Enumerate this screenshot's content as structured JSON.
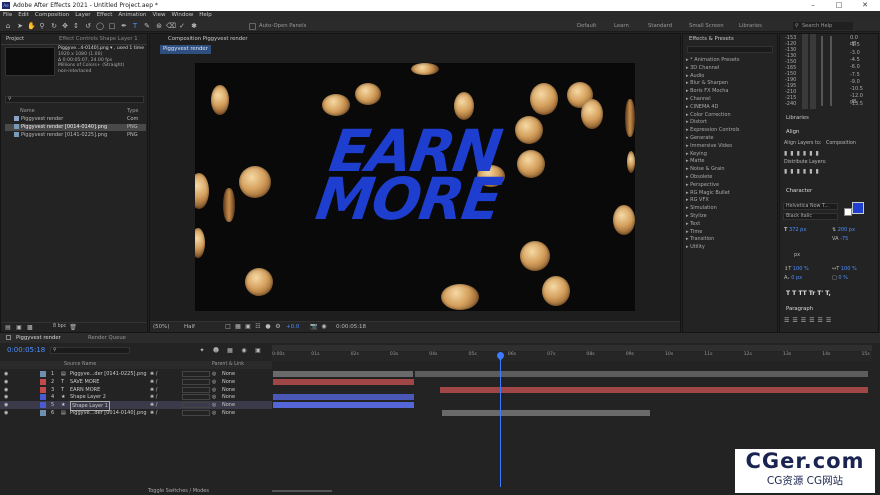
{
  "window": {
    "title": "Adobe After Effects 2021 - Untitled Project.aep *"
  },
  "menu": [
    "File",
    "Edit",
    "Composition",
    "Layer",
    "Effect",
    "Animation",
    "View",
    "Window",
    "Help"
  ],
  "toolbar": {
    "auto_open": "Auto-Open Panels",
    "workspaces": [
      "Default",
      "Learn",
      "Standard",
      "Small Screen",
      "Libraries"
    ],
    "search": "Search Help"
  },
  "project": {
    "tab_project": "Project",
    "tab_effects": "Effect Controls Shape Layer 1",
    "selected": "Piggyve...4-0140].png ▾ , used 1 time",
    "info": [
      "1920 x 1080 (1.00)",
      "Δ 0:00:05:07, 24.00 fps",
      "Millions of Colors+ (Straight)",
      "non-interlaced"
    ],
    "col_name": "Name",
    "col_type": "Type",
    "items": [
      {
        "name": "Piggyvest render",
        "type": "Com"
      },
      {
        "name": "Piggyvest render [0014-0140].png",
        "type": "PNG"
      },
      {
        "name": "Piggyvest render [0141-0225].png",
        "type": "PNG"
      }
    ],
    "bpc": "8 bpc"
  },
  "composition": {
    "tab": "Composition Piggyvest render",
    "crumb": "Piggyvest render",
    "headline": [
      "EARN",
      "MORE"
    ],
    "zoom": "(50%)",
    "quality": "Half",
    "exposure": "+0.0",
    "timecode": "0:00:05:18"
  },
  "effects_presets": {
    "title": "Effects & Presets",
    "items": [
      "* Animation Presets",
      "3D Channel",
      "Audio",
      "Blur & Sharpen",
      "Boris FX Mocha",
      "Channel",
      "CINEMA 4D",
      "Color Correction",
      "Distort",
      "Expression Controls",
      "Generate",
      "Immersive Video",
      "Keying",
      "Matte",
      "Noise & Grain",
      "Obsolete",
      "Perspective",
      "RG Magic Bullet",
      "RG VFX",
      "Simulation",
      "Stylize",
      "Text",
      "Time",
      "Transition",
      "Utility"
    ]
  },
  "audio": {
    "left_db": [
      "-153",
      "-120",
      "-130",
      "-130",
      "-150",
      "-165",
      "-150",
      "-190",
      "-195",
      "-210",
      "-215",
      "-240"
    ],
    "right_db": [
      "0.0 dB",
      "-1.5",
      "-3.0",
      "-4.5",
      "-6.0",
      "-7.5",
      "-9.0",
      "-10.5",
      "-12.0 dB",
      "-13.5"
    ]
  },
  "right": {
    "libraries": "Libraries",
    "align": "Align",
    "align_to_label": "Align Layers to:",
    "align_to": "Composition",
    "distribute": "Distribute Layers:",
    "character": "Character",
    "font": "Helvetica Now T...",
    "style": "Black Italic",
    "size": "372 px",
    "leading": "200 px",
    "tracking": "-75",
    "px_unit": "px",
    "vscale": "100 %",
    "hscale": "100 %",
    "baseline": "0 px",
    "tsume": "0 %",
    "text_style": "T  T  TT Tr  T'  T,",
    "paragraph": "Paragraph"
  },
  "timeline": {
    "tab_comp": "Piggyvest render",
    "tab_queue": "Render Queue",
    "timecode": "0:00:05:18",
    "col_source": "Source Name",
    "col_parent": "Parent & Link",
    "layers": [
      {
        "num": "1",
        "name": "Piggyve...der [0141-0225].png",
        "parent": "None",
        "color": "#6e8fb0",
        "icon": "img"
      },
      {
        "num": "2",
        "name": "SAVE MORE",
        "parent": "None",
        "color": "#c24a4a",
        "icon": "T"
      },
      {
        "num": "3",
        "name": "EARN MORE",
        "parent": "None",
        "color": "#c24a4a",
        "icon": "T"
      },
      {
        "num": "4",
        "name": "Shape Layer 2",
        "parent": "None",
        "color": "#4a5ad0",
        "icon": "★"
      },
      {
        "num": "5",
        "name": "Shape Layer 1",
        "parent": "None",
        "color": "#4a5ad0",
        "icon": "★"
      },
      {
        "num": "6",
        "name": "Piggyve...der [0014-0140].png",
        "parent": "None",
        "color": "#6e8fb0",
        "icon": "img"
      }
    ],
    "ruler": [
      "0:00s",
      "01s",
      "02s",
      "03s",
      "04s",
      "05s",
      "06s",
      "07s",
      "08s",
      "09s",
      "10s",
      "11s",
      "12s",
      "13s",
      "14s",
      "15s"
    ],
    "footer": "Toggle Switches / Modes"
  },
  "watermark": {
    "line1": "CGer.com",
    "line2": "CG资源  CG网站"
  },
  "colors": {
    "accent": "#3c7bff",
    "red_label": "#c24a4a",
    "blue_label": "#4a5ad0",
    "gray_bar": "#8a8a8a"
  }
}
